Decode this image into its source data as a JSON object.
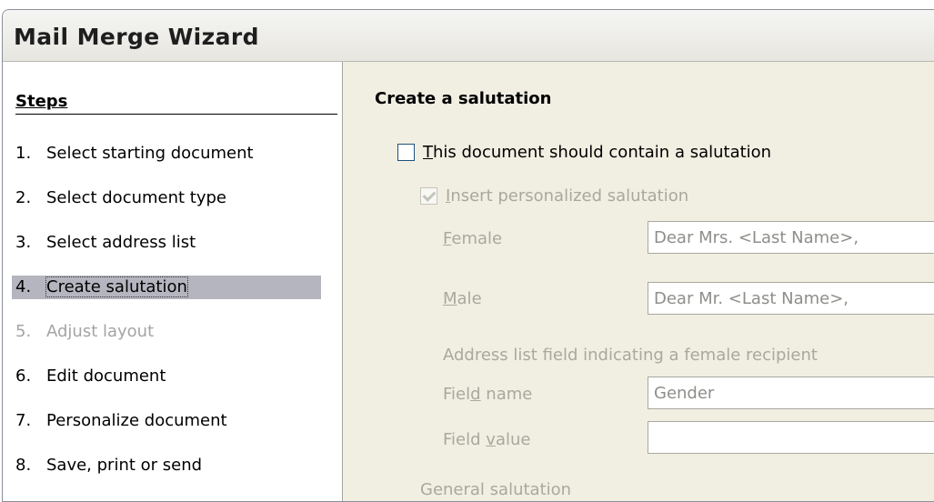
{
  "window": {
    "title": "Mail Merge Wizard"
  },
  "steps": {
    "header": "Steps",
    "items": [
      {
        "num": "1.",
        "label": "Select starting document",
        "state": "normal"
      },
      {
        "num": "2.",
        "label": "Select document type",
        "state": "normal"
      },
      {
        "num": "3.",
        "label": "Select address list",
        "state": "normal"
      },
      {
        "num": "4.",
        "label": "Create salutation",
        "state": "active"
      },
      {
        "num": "5.",
        "label": "Adjust layout",
        "state": "disabled"
      },
      {
        "num": "6.",
        "label": "Edit document",
        "state": "normal"
      },
      {
        "num": "7.",
        "label": "Personalize document",
        "state": "normal"
      },
      {
        "num": "8.",
        "label": "Save, print or send",
        "state": "normal"
      }
    ]
  },
  "salutation": {
    "title": "Create a salutation",
    "contain_checkbox": {
      "access": "T",
      "label_rest": "his document should contain a salutation",
      "checked": false
    },
    "personalized_checkbox": {
      "access": "I",
      "label_rest": "nsert personalized salutation",
      "checked": true
    },
    "female": {
      "access": "F",
      "label_rest": "emale",
      "value": "Dear Mrs. <Last Name>,"
    },
    "male": {
      "access": "M",
      "label_rest": "ale",
      "value": "Dear Mr. <Last Name>,"
    },
    "address_list_caption": "Address list field indicating a female recipient",
    "field_name": {
      "pre": "Fiel",
      "access": "d",
      "post": " name",
      "value": "Gender"
    },
    "field_value": {
      "pre": "Field ",
      "access": "v",
      "post": "alue",
      "value": ""
    },
    "general_salutation": "General salutation"
  }
}
